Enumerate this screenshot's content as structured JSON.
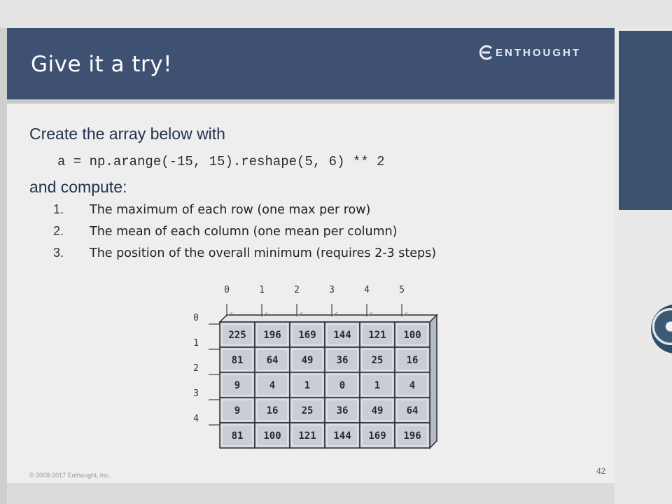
{
  "slide": {
    "title": "Give it a try!",
    "logo_text": "ENTHOUGHT",
    "heading": "Create the array below with",
    "code": "a = np.arange(-15, 15).reshape(5, 6) ** 2",
    "compute_label": "and compute:",
    "tasks": [
      {
        "num": "1.",
        "text": "The maximum of each row (one max per row)"
      },
      {
        "num": "2.",
        "text": "The mean of each column (one mean per column)"
      },
      {
        "num": "3.",
        "text": "The position of the overall minimum (requires 2-3 steps)"
      }
    ],
    "footer": "© 2008-2017 Enthought, Inc.",
    "page_number": "42"
  },
  "array_diagram": {
    "col_indices": [
      "0",
      "1",
      "2",
      "3",
      "4",
      "5"
    ],
    "row_indices": [
      "0",
      "1",
      "2",
      "3",
      "4"
    ],
    "rows": [
      [
        "225",
        "196",
        "169",
        "144",
        "121",
        "100"
      ],
      [
        "81",
        "64",
        "49",
        "36",
        "25",
        "16"
      ],
      [
        "9",
        "4",
        "1",
        "0",
        "1",
        "4"
      ],
      [
        "9",
        "16",
        "25",
        "36",
        "49",
        "64"
      ],
      [
        "81",
        "100",
        "121",
        "144",
        "169",
        "196"
      ]
    ],
    "colors": {
      "cell_fill": "#c9ced6",
      "cell_stroke": "#2b2b2b",
      "top_face": "#e4e7ec",
      "side_face": "#b5bbc5"
    }
  }
}
